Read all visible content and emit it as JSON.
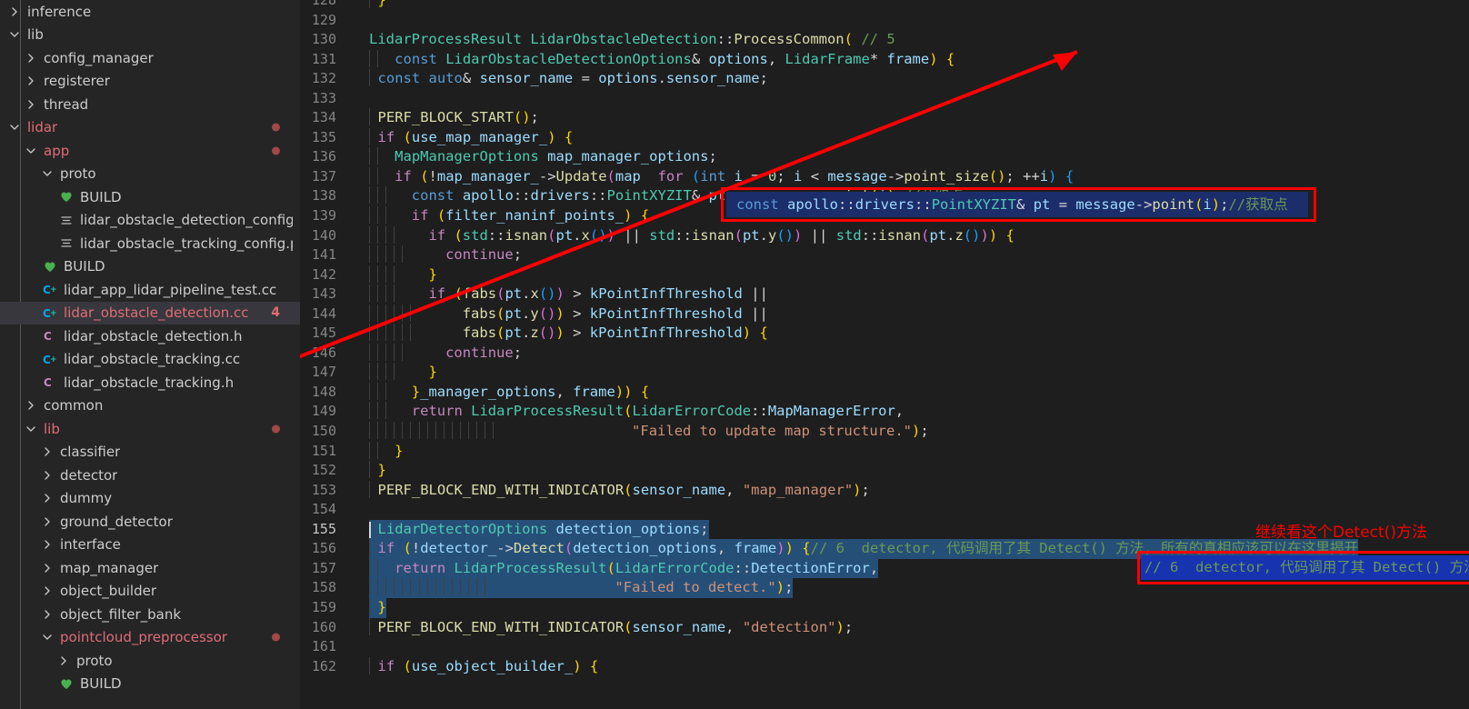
{
  "colors": {
    "sidebar_bg": "#252526",
    "editor_bg": "#1e1e1e",
    "selection_blue": "#264f78",
    "overlay_navy": "#1c2d6b",
    "annotation_blue": "#1733b0",
    "annotation_red": "#ff0000",
    "modified_dot": "#a04848",
    "selected_row": "#37373d",
    "git_modified_text": "#e06c75"
  },
  "sidebar": {
    "items": [
      {
        "label": "inference",
        "indent": 0,
        "icon": "chevron-right-icon",
        "color": "white",
        "badge": "",
        "dot": false,
        "selected": false
      },
      {
        "label": "lib",
        "indent": 0,
        "icon": "chevron-down-icon",
        "color": "white",
        "badge": "",
        "dot": false,
        "selected": false
      },
      {
        "label": "config_manager",
        "indent": 1,
        "icon": "chevron-right-icon",
        "color": "white",
        "badge": "",
        "dot": false,
        "selected": false
      },
      {
        "label": "registerer",
        "indent": 1,
        "icon": "chevron-right-icon",
        "color": "white",
        "badge": "",
        "dot": false,
        "selected": false
      },
      {
        "label": "thread",
        "indent": 1,
        "icon": "chevron-right-icon",
        "color": "white",
        "badge": "",
        "dot": false,
        "selected": false
      },
      {
        "label": "lidar",
        "indent": 0,
        "icon": "chevron-down-icon",
        "color": "red",
        "badge": "",
        "dot": true,
        "selected": false
      },
      {
        "label": "app",
        "indent": 1,
        "icon": "chevron-down-icon",
        "color": "red",
        "badge": "",
        "dot": true,
        "selected": false
      },
      {
        "label": "proto",
        "indent": 2,
        "icon": "chevron-down-icon",
        "color": "white",
        "badge": "",
        "dot": false,
        "selected": false
      },
      {
        "label": "BUILD",
        "indent": 3,
        "icon": "bazel-heart-icon",
        "color": "white",
        "badge": "",
        "dot": false,
        "selected": false
      },
      {
        "label": "lidar_obstacle_detection_config.proto",
        "indent": 3,
        "icon": "proto-file-icon",
        "color": "white",
        "badge": "",
        "dot": false,
        "selected": false
      },
      {
        "label": "lidar_obstacle_tracking_config.proto",
        "indent": 3,
        "icon": "proto-file-icon",
        "color": "white",
        "badge": "",
        "dot": false,
        "selected": false
      },
      {
        "label": "BUILD",
        "indent": 2,
        "icon": "bazel-heart-icon",
        "color": "white",
        "badge": "",
        "dot": false,
        "selected": false
      },
      {
        "label": "lidar_app_lidar_pipeline_test.cc",
        "indent": 2,
        "icon": "cpp-source-icon",
        "color": "white",
        "badge": "",
        "dot": false,
        "selected": false
      },
      {
        "label": "lidar_obstacle_detection.cc",
        "indent": 2,
        "icon": "cpp-source-icon",
        "color": "red",
        "badge": "4",
        "dot": false,
        "selected": true
      },
      {
        "label": "lidar_obstacle_detection.h",
        "indent": 2,
        "icon": "cpp-header-icon",
        "color": "white",
        "badge": "",
        "dot": false,
        "selected": false
      },
      {
        "label": "lidar_obstacle_tracking.cc",
        "indent": 2,
        "icon": "cpp-source-icon",
        "color": "white",
        "badge": "",
        "dot": false,
        "selected": false
      },
      {
        "label": "lidar_obstacle_tracking.h",
        "indent": 2,
        "icon": "cpp-header-icon",
        "color": "white",
        "badge": "",
        "dot": false,
        "selected": false
      },
      {
        "label": "common",
        "indent": 1,
        "icon": "chevron-right-icon",
        "color": "white",
        "badge": "",
        "dot": false,
        "selected": false
      },
      {
        "label": "lib",
        "indent": 1,
        "icon": "chevron-down-icon",
        "color": "red",
        "badge": "",
        "dot": true,
        "selected": false
      },
      {
        "label": "classifier",
        "indent": 2,
        "icon": "chevron-right-icon",
        "color": "white",
        "badge": "",
        "dot": false,
        "selected": false
      },
      {
        "label": "detector",
        "indent": 2,
        "icon": "chevron-right-icon",
        "color": "white",
        "badge": "",
        "dot": false,
        "selected": false
      },
      {
        "label": "dummy",
        "indent": 2,
        "icon": "chevron-right-icon",
        "color": "white",
        "badge": "",
        "dot": false,
        "selected": false
      },
      {
        "label": "ground_detector",
        "indent": 2,
        "icon": "chevron-right-icon",
        "color": "white",
        "badge": "",
        "dot": false,
        "selected": false
      },
      {
        "label": "interface",
        "indent": 2,
        "icon": "chevron-right-icon",
        "color": "white",
        "badge": "",
        "dot": false,
        "selected": false
      },
      {
        "label": "map_manager",
        "indent": 2,
        "icon": "chevron-right-icon",
        "color": "white",
        "badge": "",
        "dot": false,
        "selected": false
      },
      {
        "label": "object_builder",
        "indent": 2,
        "icon": "chevron-right-icon",
        "color": "white",
        "badge": "",
        "dot": false,
        "selected": false
      },
      {
        "label": "object_filter_bank",
        "indent": 2,
        "icon": "chevron-right-icon",
        "color": "white",
        "badge": "",
        "dot": false,
        "selected": false
      },
      {
        "label": "pointcloud_preprocessor",
        "indent": 2,
        "icon": "chevron-down-icon",
        "color": "red",
        "badge": "",
        "dot": true,
        "selected": false
      },
      {
        "label": "proto",
        "indent": 3,
        "icon": "chevron-right-icon",
        "color": "white",
        "badge": "",
        "dot": false,
        "selected": false
      },
      {
        "label": "BUILD",
        "indent": 3,
        "icon": "bazel-heart-icon",
        "color": "white",
        "badge": "",
        "dot": false,
        "selected": false
      }
    ]
  },
  "editor": {
    "first_line": 128,
    "current_line": 155,
    "lines": [
      {
        "n": "128",
        "text": "  }"
      },
      {
        "n": "129",
        "text": ""
      },
      {
        "n": "130",
        "text": "LidarProcessResult LidarObstacleDetection::ProcessCommon( // 5"
      },
      {
        "n": "131",
        "text": "    const LidarObstacleDetectionOptions& options, LidarFrame* frame) {"
      },
      {
        "n": "132",
        "text": "  const auto& sensor_name = options.sensor_name;"
      },
      {
        "n": "133",
        "text": ""
      },
      {
        "n": "134",
        "text": "  PERF_BLOCK_START();"
      },
      {
        "n": "135",
        "text": "  if (use_map_manager_) {"
      },
      {
        "n": "136",
        "text": "    MapManagerOptions map_manager_options;"
      },
      {
        "n": "137",
        "text": "    if (!map_manager_->Update(map  for (int i = 0; i < message->point_size(); ++i) {"
      },
      {
        "n": "138",
        "text": "      const apollo::drivers::PointXYZIT& pt = message->point(i);//获取点"
      },
      {
        "n": "139",
        "text": "      if (filter_naninf_points_) {"
      },
      {
        "n": "140",
        "text": "        if (std::isnan(pt.x()) || std::isnan(pt.y()) || std::isnan(pt.z())) {"
      },
      {
        "n": "141",
        "text": "          continue;"
      },
      {
        "n": "142",
        "text": "        }"
      },
      {
        "n": "143",
        "text": "        if (fabs(pt.x()) > kPointInfThreshold ||"
      },
      {
        "n": "144",
        "text": "            fabs(pt.y()) > kPointInfThreshold ||"
      },
      {
        "n": "145",
        "text": "            fabs(pt.z()) > kPointInfThreshold) {"
      },
      {
        "n": "146",
        "text": "          continue;"
      },
      {
        "n": "147",
        "text": "        }"
      },
      {
        "n": "148",
        "text": "      }_manager_options, frame)) {"
      },
      {
        "n": "149",
        "text": "      return LidarProcessResult(LidarErrorCode::MapManagerError,"
      },
      {
        "n": "150",
        "text": "                                \"Failed to update map structure.\");"
      },
      {
        "n": "151",
        "text": "    }"
      },
      {
        "n": "152",
        "text": "  }"
      },
      {
        "n": "153",
        "text": "  PERF_BLOCK_END_WITH_INDICATOR(sensor_name, \"map_manager\");"
      },
      {
        "n": "154",
        "text": ""
      },
      {
        "n": "155",
        "text": "  LidarDetectorOptions detection_options;"
      },
      {
        "n": "156",
        "text": "  if (!detector_->Detect(detection_options, frame)) {// 6  detector, 代码调用了其 Detect() 方法, 所有的真相应该可以在这里揭开"
      },
      {
        "n": "157",
        "text": "    return LidarProcessResult(LidarErrorCode::DetectionError,"
      },
      {
        "n": "158",
        "text": "                              \"Failed to detect.\");"
      },
      {
        "n": "159",
        "text": "  }"
      },
      {
        "n": "160",
        "text": "  PERF_BLOCK_END_WITH_INDICATOR(sensor_name, \"detection\");"
      },
      {
        "n": "161",
        "text": ""
      },
      {
        "n": "162",
        "text": "  if (use_object_builder_) {"
      }
    ]
  },
  "overlay_fragment": {
    "text": "const apollo::drivers::PointXYZIT& pt = message->point(i);//获取点"
  },
  "annotations": {
    "callout_text": "继续看这个Detect()方法",
    "inline_comment": "// 6  detector, 代码调用了其 Detect() 方法, 所有的真相应该可以在这里揭开"
  }
}
